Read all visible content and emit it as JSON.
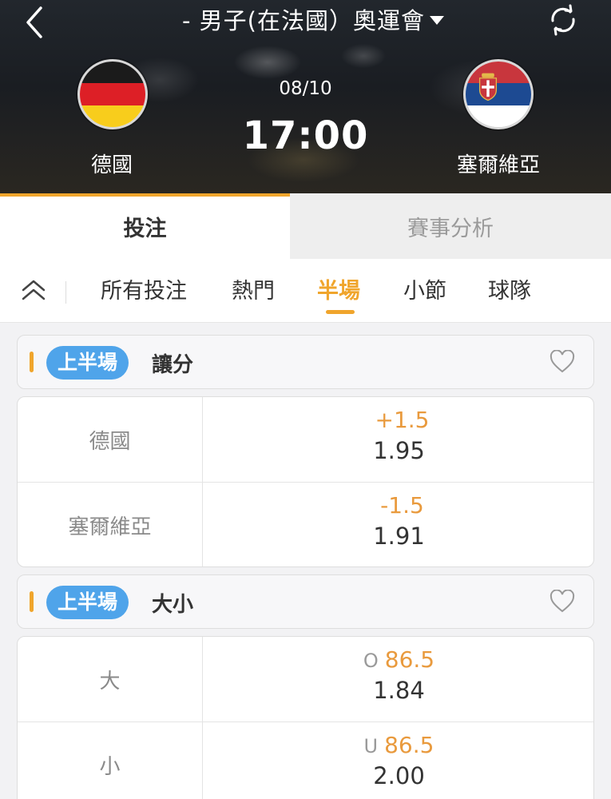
{
  "header": {
    "title": "- 男子(在法國）奧運會",
    "match_date": "08/10",
    "match_time": "17:00",
    "home_team": {
      "name": "德國",
      "flag": "germany-flag"
    },
    "away_team": {
      "name": "塞爾維亞",
      "flag": "serbia-flag"
    }
  },
  "main_tabs": [
    {
      "label": "投注",
      "active": true
    },
    {
      "label": "賽事分析",
      "active": false
    }
  ],
  "sub_tabs": [
    {
      "label": "所有投注"
    },
    {
      "label": "熱門"
    },
    {
      "label": "半場",
      "active": true
    },
    {
      "label": "小節"
    },
    {
      "label": "球隊"
    }
  ],
  "markets": [
    {
      "badge": "上半場",
      "title": "讓分",
      "rows": [
        {
          "label": "德國",
          "prefix": "",
          "line": "+1.5",
          "price": "1.95"
        },
        {
          "label": "塞爾維亞",
          "prefix": "",
          "line": "-1.5",
          "price": "1.91"
        }
      ]
    },
    {
      "badge": "上半場",
      "title": "大小",
      "rows": [
        {
          "label": "大",
          "prefix": "O",
          "line": "86.5",
          "price": "1.84"
        },
        {
          "label": "小",
          "prefix": "U",
          "line": "86.5",
          "price": "2.00"
        }
      ]
    }
  ],
  "colors": {
    "accent": "#f0a52c",
    "badge": "#4fa4ea",
    "odds_line": "#e99a3d"
  }
}
